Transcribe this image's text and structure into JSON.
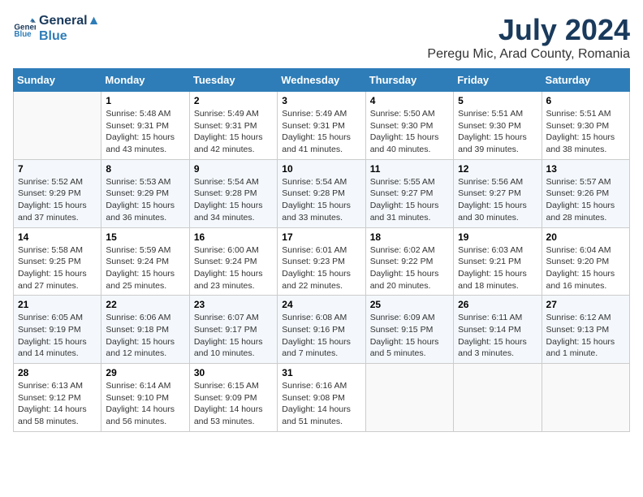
{
  "logo": {
    "line1": "General",
    "line2": "Blue"
  },
  "title": "July 2024",
  "location": "Peregu Mic, Arad County, Romania",
  "weekdays": [
    "Sunday",
    "Monday",
    "Tuesday",
    "Wednesday",
    "Thursday",
    "Friday",
    "Saturday"
  ],
  "weeks": [
    [
      {
        "day": "",
        "info": ""
      },
      {
        "day": "1",
        "info": "Sunrise: 5:48 AM\nSunset: 9:31 PM\nDaylight: 15 hours\nand 43 minutes."
      },
      {
        "day": "2",
        "info": "Sunrise: 5:49 AM\nSunset: 9:31 PM\nDaylight: 15 hours\nand 42 minutes."
      },
      {
        "day": "3",
        "info": "Sunrise: 5:49 AM\nSunset: 9:31 PM\nDaylight: 15 hours\nand 41 minutes."
      },
      {
        "day": "4",
        "info": "Sunrise: 5:50 AM\nSunset: 9:30 PM\nDaylight: 15 hours\nand 40 minutes."
      },
      {
        "day": "5",
        "info": "Sunrise: 5:51 AM\nSunset: 9:30 PM\nDaylight: 15 hours\nand 39 minutes."
      },
      {
        "day": "6",
        "info": "Sunrise: 5:51 AM\nSunset: 9:30 PM\nDaylight: 15 hours\nand 38 minutes."
      }
    ],
    [
      {
        "day": "7",
        "info": "Sunrise: 5:52 AM\nSunset: 9:29 PM\nDaylight: 15 hours\nand 37 minutes."
      },
      {
        "day": "8",
        "info": "Sunrise: 5:53 AM\nSunset: 9:29 PM\nDaylight: 15 hours\nand 36 minutes."
      },
      {
        "day": "9",
        "info": "Sunrise: 5:54 AM\nSunset: 9:28 PM\nDaylight: 15 hours\nand 34 minutes."
      },
      {
        "day": "10",
        "info": "Sunrise: 5:54 AM\nSunset: 9:28 PM\nDaylight: 15 hours\nand 33 minutes."
      },
      {
        "day": "11",
        "info": "Sunrise: 5:55 AM\nSunset: 9:27 PM\nDaylight: 15 hours\nand 31 minutes."
      },
      {
        "day": "12",
        "info": "Sunrise: 5:56 AM\nSunset: 9:27 PM\nDaylight: 15 hours\nand 30 minutes."
      },
      {
        "day": "13",
        "info": "Sunrise: 5:57 AM\nSunset: 9:26 PM\nDaylight: 15 hours\nand 28 minutes."
      }
    ],
    [
      {
        "day": "14",
        "info": "Sunrise: 5:58 AM\nSunset: 9:25 PM\nDaylight: 15 hours\nand 27 minutes."
      },
      {
        "day": "15",
        "info": "Sunrise: 5:59 AM\nSunset: 9:24 PM\nDaylight: 15 hours\nand 25 minutes."
      },
      {
        "day": "16",
        "info": "Sunrise: 6:00 AM\nSunset: 9:24 PM\nDaylight: 15 hours\nand 23 minutes."
      },
      {
        "day": "17",
        "info": "Sunrise: 6:01 AM\nSunset: 9:23 PM\nDaylight: 15 hours\nand 22 minutes."
      },
      {
        "day": "18",
        "info": "Sunrise: 6:02 AM\nSunset: 9:22 PM\nDaylight: 15 hours\nand 20 minutes."
      },
      {
        "day": "19",
        "info": "Sunrise: 6:03 AM\nSunset: 9:21 PM\nDaylight: 15 hours\nand 18 minutes."
      },
      {
        "day": "20",
        "info": "Sunrise: 6:04 AM\nSunset: 9:20 PM\nDaylight: 15 hours\nand 16 minutes."
      }
    ],
    [
      {
        "day": "21",
        "info": "Sunrise: 6:05 AM\nSunset: 9:19 PM\nDaylight: 15 hours\nand 14 minutes."
      },
      {
        "day": "22",
        "info": "Sunrise: 6:06 AM\nSunset: 9:18 PM\nDaylight: 15 hours\nand 12 minutes."
      },
      {
        "day": "23",
        "info": "Sunrise: 6:07 AM\nSunset: 9:17 PM\nDaylight: 15 hours\nand 10 minutes."
      },
      {
        "day": "24",
        "info": "Sunrise: 6:08 AM\nSunset: 9:16 PM\nDaylight: 15 hours\nand 7 minutes."
      },
      {
        "day": "25",
        "info": "Sunrise: 6:09 AM\nSunset: 9:15 PM\nDaylight: 15 hours\nand 5 minutes."
      },
      {
        "day": "26",
        "info": "Sunrise: 6:11 AM\nSunset: 9:14 PM\nDaylight: 15 hours\nand 3 minutes."
      },
      {
        "day": "27",
        "info": "Sunrise: 6:12 AM\nSunset: 9:13 PM\nDaylight: 15 hours\nand 1 minute."
      }
    ],
    [
      {
        "day": "28",
        "info": "Sunrise: 6:13 AM\nSunset: 9:12 PM\nDaylight: 14 hours\nand 58 minutes."
      },
      {
        "day": "29",
        "info": "Sunrise: 6:14 AM\nSunset: 9:10 PM\nDaylight: 14 hours\nand 56 minutes."
      },
      {
        "day": "30",
        "info": "Sunrise: 6:15 AM\nSunset: 9:09 PM\nDaylight: 14 hours\nand 53 minutes."
      },
      {
        "day": "31",
        "info": "Sunrise: 6:16 AM\nSunset: 9:08 PM\nDaylight: 14 hours\nand 51 minutes."
      },
      {
        "day": "",
        "info": ""
      },
      {
        "day": "",
        "info": ""
      },
      {
        "day": "",
        "info": ""
      }
    ]
  ]
}
